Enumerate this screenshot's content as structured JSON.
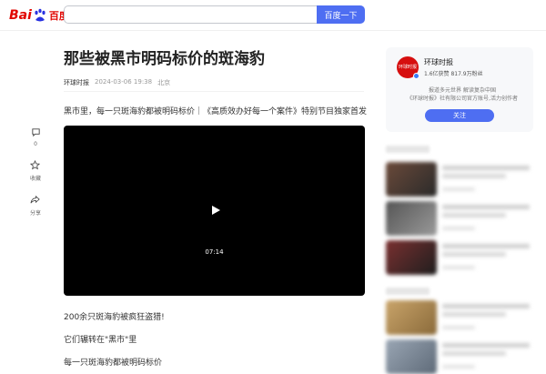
{
  "header": {
    "logo_bai": "Bai",
    "logo_du": "du",
    "logo_cn": "百度",
    "search_value": "",
    "search_button": "百度一下"
  },
  "article": {
    "title": "那些被黑市明码标价的斑海豹",
    "source": "环球时报",
    "date": "2024-03-06 19:38",
    "location": "北京",
    "lead": "黑市里，每一只斑海豹都被明码标价｜《高质效办好每一个案件》特别节目独家首发",
    "video_time": "07:14",
    "paragraphs": [
      "200余只斑海豹被疯狂盗猎!",
      "它们辗转在\"黑市\"里",
      "每一只斑海豹都被明码标价"
    ]
  },
  "side_tools": {
    "comment_count": "0",
    "collect_label": "收藏",
    "share_label": "分享"
  },
  "author_card": {
    "avatar_text": "环球时报",
    "name": "环球时报",
    "stats": "1.6亿获赞 817.9万粉丝",
    "desc_line1": "报道多元世界 解读复杂中国",
    "desc_line2": "《环球时报》社有限公司官方账号,活力创作者",
    "follow_label": "关注"
  },
  "colors": {
    "brand_red": "#e10601",
    "accent_blue": "#4e6ef2"
  }
}
